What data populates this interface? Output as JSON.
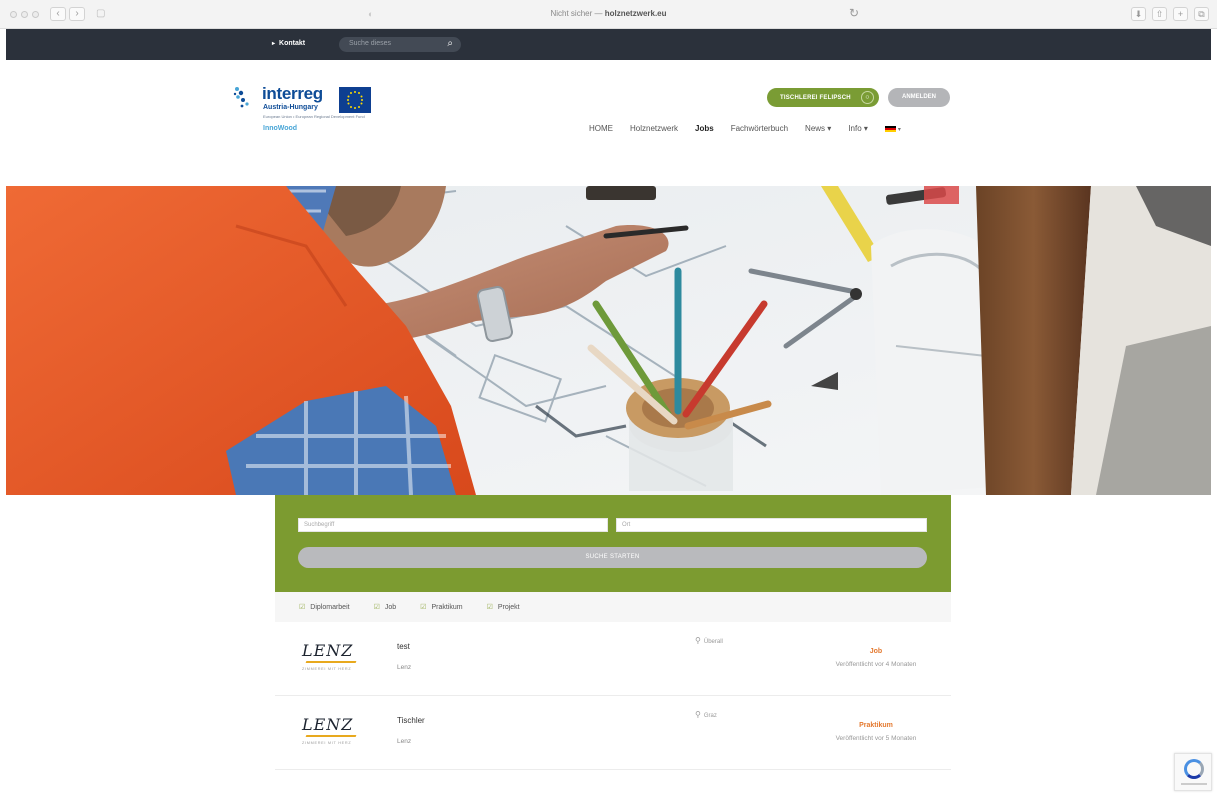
{
  "browser": {
    "url_prefix": "Nicht sicher — ",
    "url_domain": "holznetzwerk.eu"
  },
  "topbar": {
    "kontakt_label": "Kontakt",
    "search_placeholder": "Suche dieses"
  },
  "logo": {
    "name": "interreg",
    "subtitle": "Austria-Hungary",
    "tagline": "European Union • European Regional Development Fund",
    "project": "InnoWood"
  },
  "header_buttons": {
    "primary_label": "TISCHLEREI FELIPSCH",
    "secondary_label": "ANMELDEN"
  },
  "nav": {
    "items": [
      {
        "label": "HOME"
      },
      {
        "label": "Holznetzwerk"
      },
      {
        "label": "Jobs"
      },
      {
        "label": "Fachwörterbuch"
      },
      {
        "label": "News ▾"
      },
      {
        "label": "Info ▾"
      }
    ],
    "active_index": 2
  },
  "search": {
    "keyword_placeholder": "Suchbegriff",
    "location_placeholder": "Ort",
    "submit_label": "SUCHE STARTEN"
  },
  "filters": [
    {
      "label": "Diplomarbeit",
      "checked": true
    },
    {
      "label": "Job",
      "checked": true
    },
    {
      "label": "Praktikum",
      "checked": true
    },
    {
      "label": "Projekt",
      "checked": true
    }
  ],
  "jobs": [
    {
      "logo_text": "LENZ",
      "logo_tagline": "ZIMMEREI MIT HERZ",
      "title": "test",
      "company": "Lenz",
      "location": "Überall",
      "type": "Job",
      "posted": "Veröffentlicht vor 4 Monaten"
    },
    {
      "logo_text": "LENZ",
      "logo_tagline": "ZIMMEREI MIT HERZ",
      "title": "Tischler",
      "company": "Lenz",
      "location": "Graz",
      "type": "Praktikum",
      "posted": "Veröffentlicht vor 5 Monaten"
    }
  ],
  "colors": {
    "topbar": "#2b313b",
    "green": "#7c9b30",
    "orange": "#e4792f",
    "vest": "#e85a2a",
    "button_grey": "#b9babd"
  }
}
